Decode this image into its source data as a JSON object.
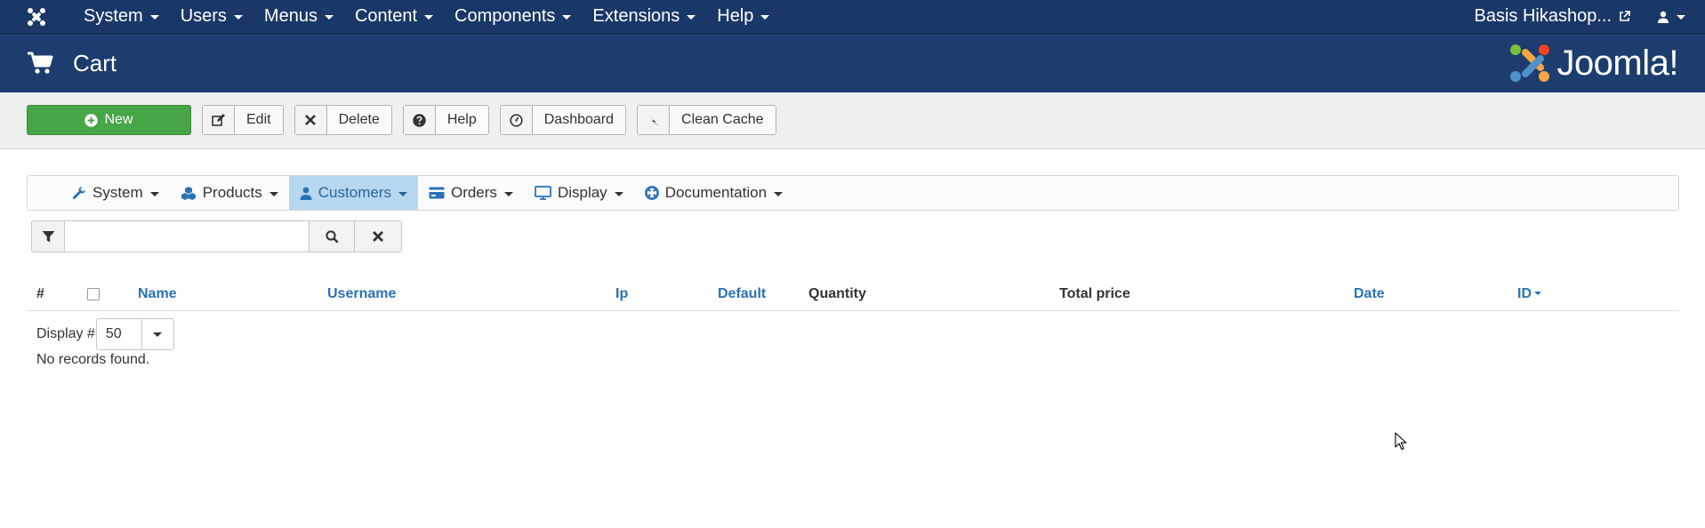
{
  "topnav": {
    "menus": [
      "System",
      "Users",
      "Menus",
      "Content",
      "Components",
      "Extensions",
      "Help"
    ],
    "site_name": "Basis Hikashop..."
  },
  "header": {
    "title": "Cart",
    "brand": "Joomla!"
  },
  "toolbar": {
    "new": "New",
    "edit": "Edit",
    "delete": "Delete",
    "help": "Help",
    "dashboard": "Dashboard",
    "clean_cache": "Clean Cache"
  },
  "submenu": {
    "items": [
      "System",
      "Products",
      "Customers",
      "Orders",
      "Display",
      "Documentation"
    ],
    "active": "Customers"
  },
  "filter": {
    "search_value": ""
  },
  "table": {
    "headers": {
      "num": "#",
      "name": "Name",
      "username": "Username",
      "ip": "Ip",
      "default": "Default",
      "quantity": "Quantity",
      "total_price": "Total price",
      "date": "Date",
      "id": "ID"
    }
  },
  "pagination": {
    "display_label": "Display #",
    "limit": "50"
  },
  "empty_message": "No records found.",
  "colors": {
    "navbar": "#1a3867",
    "header": "#1c3d6e",
    "new_button": "#46a546",
    "active_submenu": "#b5d8f0",
    "link": "#2a72b5"
  }
}
